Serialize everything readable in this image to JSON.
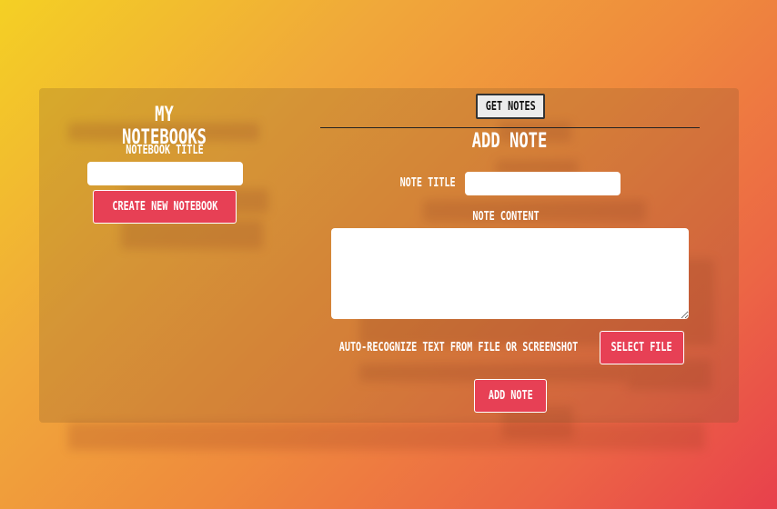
{
  "notebooks": {
    "heading": "MY NOTEBOOKS",
    "title_label": "NOTEBOOK TITLE",
    "title_input_value": "",
    "create_button": "CREATE NEW NOTEBOOK"
  },
  "toolbar": {
    "get_notes_button": "GET NOTES"
  },
  "add_note": {
    "heading": "ADD NOTE",
    "note_title_label": "NOTE TITLE",
    "note_title_value": "",
    "note_content_label": "NOTE CONTENT",
    "note_content_value": "",
    "recognize_label": "AUTO-RECOGNIZE TEXT FROM FILE OR SCREENSHOT",
    "select_file_button": "SELECT FILE",
    "add_note_button": "ADD NOTE"
  },
  "colors": {
    "accent": "#e74055",
    "gradient_start": "#f4d024",
    "gradient_end": "#e8404c"
  }
}
